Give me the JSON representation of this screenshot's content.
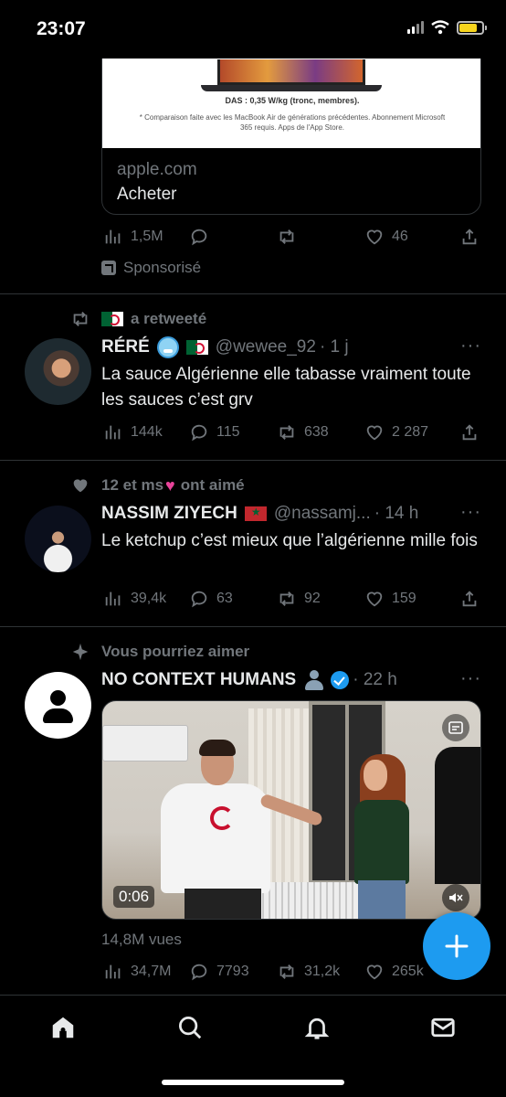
{
  "status_bar": {
    "time": "23:07"
  },
  "ad": {
    "das_text": "DAS : 0,35 W/kg (tronc, membres).",
    "note_text": "* Comparaison faite avec les MacBook Air de générations précédentes. Abonnement Microsoft 365 requis. Apps de l'App Store.",
    "domain": "apple.com",
    "cta": "Acheter",
    "stats": {
      "views": "1,5M",
      "likes": "46"
    },
    "sponsored_label": "Sponsorisé"
  },
  "tweets": [
    {
      "context": "a retweeté",
      "name": "RÉRÉ",
      "handle": "@wewee_92",
      "time": "· 1 j",
      "text": "La sauce Algérienne elle tabasse vraiment toute les sauces c’est grv",
      "stats": {
        "views": "144k",
        "replies": "115",
        "retweets": "638",
        "likes": "2 287"
      }
    },
    {
      "context": "12 et ms",
      "context_suffix": "ont aimé",
      "name": "NASSIM ZIYECH",
      "handle": "@nassamj...",
      "time": "· 14 h",
      "text": "Le ketchup c’est mieux que l’algérienne mille fois",
      "stats": {
        "views": "39,4k",
        "replies": "63",
        "retweets": "92",
        "likes": "159"
      }
    },
    {
      "context": "Vous pourriez aimer",
      "name": "NO CONTEXT HUMANS",
      "time": "· 22 h",
      "video_time": "0:06",
      "views_label": "14,8M vues",
      "stats": {
        "views": "34,7M",
        "replies": "7793",
        "retweets": "31,2k",
        "likes": "265k"
      }
    }
  ],
  "more_label": "···",
  "colors": {
    "accent": "#1d9bf0",
    "muted": "#71767b",
    "background": "#000000"
  },
  "icons": [
    "views-icon",
    "reply-icon",
    "retweet-icon",
    "like-icon",
    "share-icon",
    "home-icon",
    "search-icon",
    "notifications-icon",
    "messages-icon",
    "compose-icon"
  ]
}
